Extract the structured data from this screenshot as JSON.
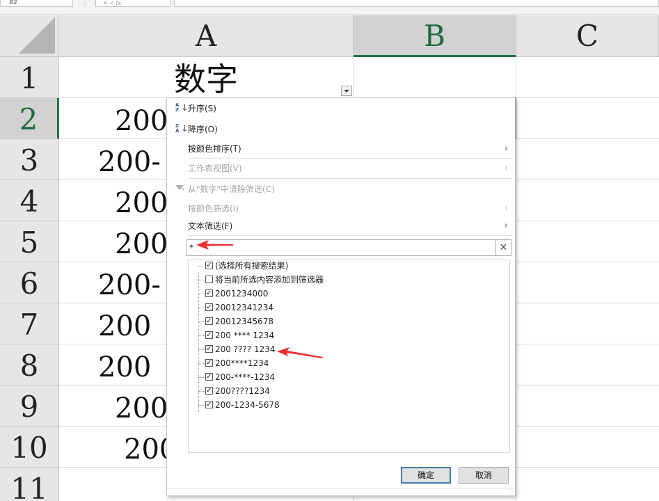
{
  "toolbar": {
    "name_box": "B2",
    "formula_dots": "⋮",
    "formula_buttons": "✕ ✓ fx"
  },
  "columns": [
    "A",
    "B",
    "C"
  ],
  "rows": [
    "1",
    "2",
    "3",
    "4",
    "5",
    "6",
    "7",
    "8",
    "9",
    "10",
    "11"
  ],
  "cells": {
    "A1": "数字",
    "A2": "200",
    "A3": "200-",
    "A4": "200",
    "A5": "200",
    "A6": "200-",
    "A7": "200",
    "A8": "200",
    "A9": "200",
    "A10": "200"
  },
  "filter_menu": {
    "sort_asc": "升序(S)",
    "sort_desc": "降序(O)",
    "sort_by_color": "按颜色排序(T)",
    "sheet_view": "工作表视图(V)",
    "clear_filter": "从\"数字\"中清除筛选(C)",
    "filter_by_color": "按颜色筛选(I)",
    "text_filter": "文本筛选(F)",
    "search_value": "*",
    "clear_search": "✕",
    "list_items": [
      {
        "label": "(选择所有搜索结果)",
        "checked": true
      },
      {
        "label": "将当前所选内容添加到筛选器",
        "checked": false
      },
      {
        "label": "2001234000",
        "checked": true
      },
      {
        "label": "20012341234",
        "checked": true
      },
      {
        "label": "20012345678",
        "checked": true
      },
      {
        "label": "200 **** 1234",
        "checked": true
      },
      {
        "label": "200 ???? 1234",
        "checked": true
      },
      {
        "label": "200****1234",
        "checked": true
      },
      {
        "label": "200-****-1234",
        "checked": true
      },
      {
        "label": "200????1234",
        "checked": true
      },
      {
        "label": "200-1234-5678",
        "checked": true
      }
    ],
    "ok_label": "确定",
    "cancel_label": "取消"
  },
  "colors": {
    "excel_green": "#217346",
    "annotation_red": "#e8302f"
  }
}
